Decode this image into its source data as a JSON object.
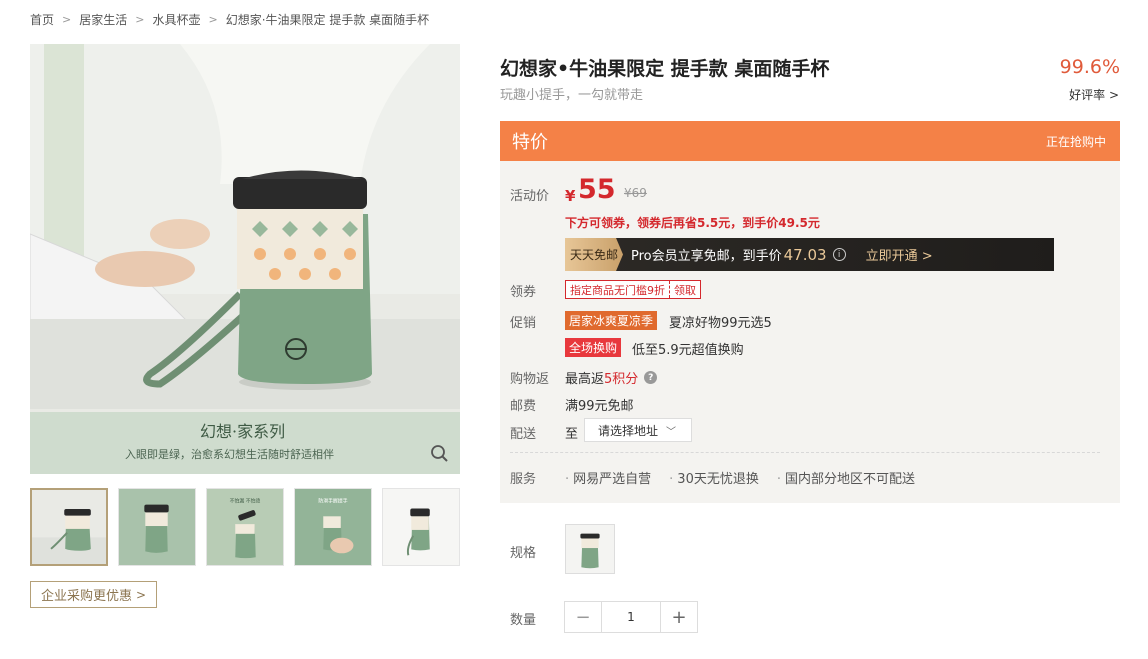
{
  "breadcrumb": [
    "首页",
    "居家生活",
    "水具杯壶",
    "幻想家·牛油果限定 提手款 桌面随手杯"
  ],
  "gallery": {
    "overlay_title": "幻想·家系列",
    "overlay_subtitle": "入眼即是绿，治愈系幻想生活随时舒适相伴",
    "thumb_captions": [
      "",
      "",
      "不怕漏 不怕烫",
      "防滑手握提手",
      ""
    ],
    "zoom_icon": "search-icon"
  },
  "enterprise_button": "企业采购更优惠",
  "product": {
    "title": "幻想家•牛油果限定 提手款 桌面随手杯",
    "subtitle": "玩趣小提手，一勾就带走",
    "rating": "99.6%",
    "rating_label": "好评率 >"
  },
  "promo_bar": {
    "title": "特价",
    "status": "正在抢购中"
  },
  "price": {
    "label": "活动价",
    "currency": "¥",
    "value": "55",
    "original": "¥69",
    "coupon_tip": "下方可领券，领券后再省5.5元，到手价49.5元"
  },
  "pro_banner": {
    "tag": "天天免邮",
    "text": "Pro会员立享免邮，到手价",
    "price": "47.03",
    "info_icon": "info-icon",
    "link": "立即开通 >"
  },
  "coupon": {
    "label": "领券",
    "main": "指定商品无门槛9折",
    "get": "领取"
  },
  "promotion": {
    "label": "促销",
    "items": [
      {
        "tag": "居家冰爽夏凉季",
        "desc": "夏凉好物99元选5"
      },
      {
        "tag": "全场换购",
        "desc": "低至5.9元超值换购"
      }
    ]
  },
  "cashback": {
    "label": "购物返",
    "prefix": "最高返",
    "points": "5积分",
    "help": "?"
  },
  "shipping": {
    "label": "邮费",
    "text": "满99元免邮"
  },
  "delivery": {
    "label": "配送",
    "to": "至",
    "address_placeholder": "请选择地址",
    "chevron": "﹀"
  },
  "service": {
    "label": "服务",
    "items": [
      "网易严选自营",
      "30天无忧退换",
      "国内部分地区不可配送"
    ]
  },
  "spec": {
    "label": "规格"
  },
  "quantity": {
    "label": "数量",
    "minus": "−",
    "value": "1",
    "plus": "+"
  },
  "colors": {
    "accent_orange": "#f48147",
    "price_red": "#d4282d",
    "gold": "#b4a078",
    "cup_green": "#7fa586"
  }
}
